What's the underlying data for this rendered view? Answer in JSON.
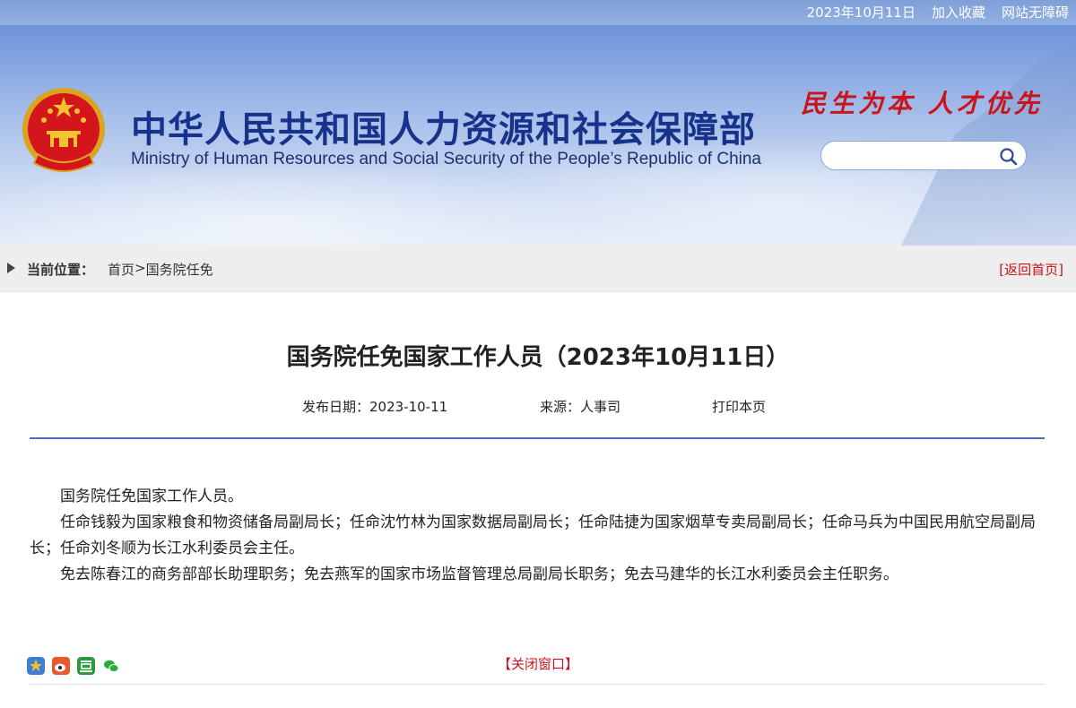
{
  "topbar": {
    "date": "2023年10月11日",
    "bookmark": "加入收藏",
    "accessibility": "网站无障碍"
  },
  "header": {
    "title_cn": "中华人民共和国人力资源和社会保障部",
    "title_en": "Ministry of Human Resources and Social Security of the People’s Republic of China",
    "slogan": "民生为本 人才优先",
    "search": {
      "value": "",
      "placeholder": ""
    }
  },
  "breadcrumb": {
    "label": "当前位置：",
    "home": "首页",
    "separator": ">",
    "current": "国务院任免",
    "back": "[返回首页]"
  },
  "article": {
    "title": "国务院任免国家工作人员（2023年10月11日）",
    "date_label": "发布日期：2023-10-11",
    "source_label": "来源：人事司",
    "print": "打印本页",
    "paragraphs": [
      "国务院任免国家工作人员。",
      "任命钱毅为国家粮食和物资储备局副局长；任命沈竹林为国家数据局副局长；任命陆捷为国家烟草专卖局副局长；任命马兵为中国民用航空局副局长；任命刘冬顺为长江水利委员会主任。",
      "免去陈春江的商务部部长助理职务；免去燕军的国家市场监督管理总局副局长职务；免去马建华的长江水利委员会主任职务。"
    ]
  },
  "footer": {
    "close": "【关闭窗口】",
    "share_icons": [
      "qzone-icon",
      "weibo-icon",
      "douban-icon",
      "wechat-icon"
    ]
  },
  "colors": {
    "brand_blue": "#17328a",
    "accent_red": "#c8141a",
    "divider_blue": "#4a6db8"
  }
}
